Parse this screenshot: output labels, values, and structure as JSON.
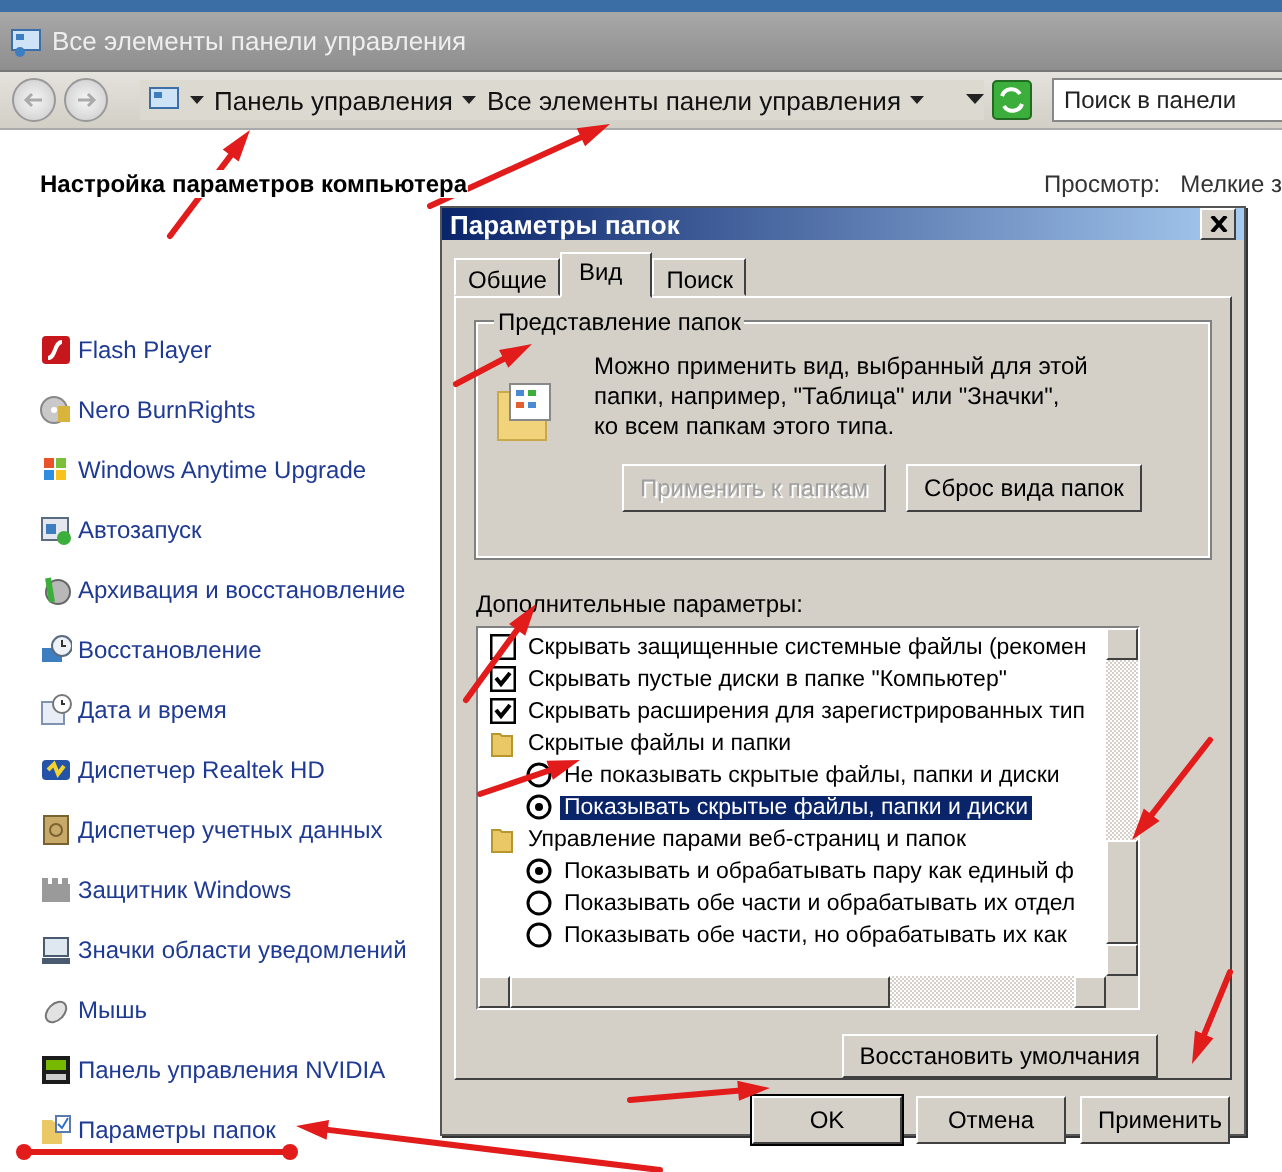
{
  "window": {
    "title": "Все элементы панели управления"
  },
  "address_bar": {
    "breadcrumbs": [
      "Панель управления",
      "Все элементы панели управления"
    ],
    "search": {
      "placeholder": "Поиск в панели"
    }
  },
  "content": {
    "heading": "Настройка параметров компьютера",
    "view_label": "Просмотр:",
    "view_value": "Мелкие з",
    "items": [
      "Flash Player",
      "Nero BurnRights",
      "Windows Anytime Upgrade",
      "Автозапуск",
      "Архивация и восстановление",
      "Восстановление",
      "Дата и время",
      "Диспетчер Realtek HD",
      "Диспетчер учетных данных",
      "Защитник Windows",
      "Значки области уведомлений",
      "Мышь",
      "Панель управления NVIDIA",
      "Параметры папок"
    ]
  },
  "dialog": {
    "title": "Параметры папок",
    "tabs": [
      {
        "label": "Общие",
        "selected": false
      },
      {
        "label": "Вид",
        "selected": true
      },
      {
        "label": "Поиск",
        "selected": false
      }
    ],
    "folder_views": {
      "title": "Представление папок",
      "lines": [
        "Можно применить вид, выбранный для этой",
        "папки, например, \"Таблица\" или \"Значки\",",
        "ко всем папкам этого типа."
      ],
      "buttons": [
        {
          "label": "Применить к папкам",
          "disabled": true
        },
        {
          "label": "Сброс вида папок",
          "disabled": false
        }
      ]
    },
    "advanced": {
      "label": "Дополнительные параметры:",
      "items": [
        {
          "kind": "checkbox",
          "label": "Скрывать защищенные системные файлы (рекомен",
          "checked": false,
          "selected": false
        },
        {
          "kind": "checkbox",
          "label": "Скрывать пустые диски в папке \"Компьютер\"",
          "checked": true,
          "selected": false
        },
        {
          "kind": "checkbox",
          "label": "Скрывать расширения для зарегистрированных тип",
          "checked": true,
          "selected": false
        },
        {
          "kind": "group",
          "label": "Скрытые файлы и папки",
          "selected": false,
          "children": [
            {
              "kind": "radio",
              "label": "Не показывать скрытые файлы, папки и диски",
              "checked": false,
              "selected": false
            },
            {
              "kind": "radio",
              "label": "Показывать скрытые файлы, папки и диски",
              "checked": true,
              "selected": true
            }
          ]
        },
        {
          "kind": "group",
          "label": "Управление парами веб-страниц и папок",
          "selected": false,
          "children": [
            {
              "kind": "radio",
              "label": "Показывать и обрабатывать пару как единый ф",
              "checked": true,
              "selected": false
            },
            {
              "kind": "radio",
              "label": "Показывать обе части и обрабатывать их отдел",
              "checked": false,
              "selected": false
            },
            {
              "kind": "radio",
              "label": "Показывать обе части, но обрабатывать их как",
              "checked": false,
              "selected": false
            }
          ]
        }
      ],
      "restore_button": "Восстановить умолчания"
    },
    "buttons": [
      "OK",
      "Отмена",
      "Применить"
    ]
  }
}
